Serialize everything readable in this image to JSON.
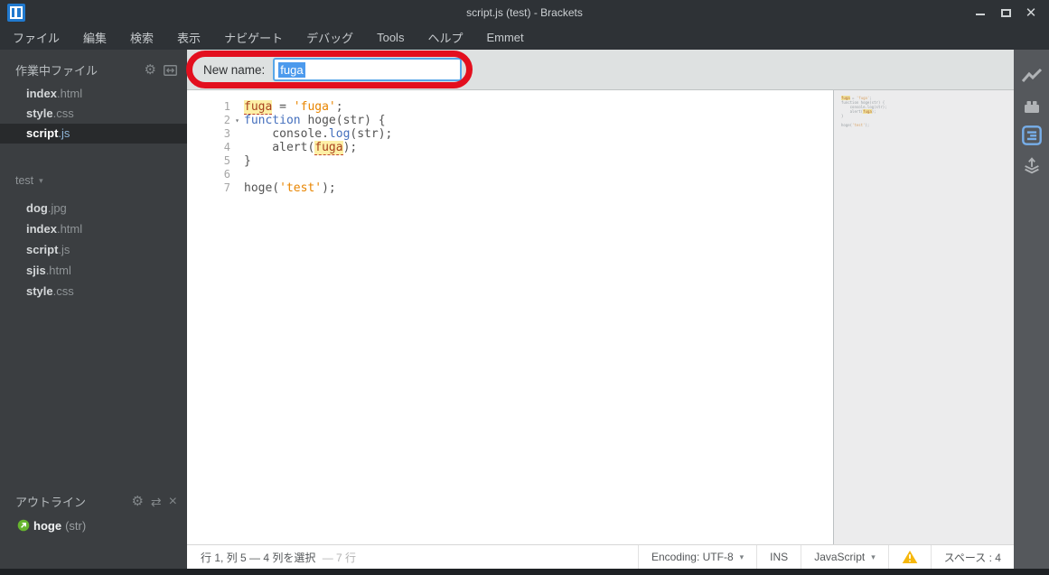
{
  "window": {
    "title": "script.js (test) - Brackets"
  },
  "menu_items": [
    "ファイル",
    "編集",
    "検索",
    "表示",
    "ナビゲート",
    "デバッグ",
    "Tools",
    "ヘルプ",
    "Emmet"
  ],
  "sidebar": {
    "working_title": "作業中ファイル",
    "working_files": [
      {
        "base": "index",
        "ext": ".html",
        "active": false
      },
      {
        "base": "style",
        "ext": ".css",
        "active": false
      },
      {
        "base": "script",
        "ext": ".js",
        "active": true
      }
    ],
    "project_name": "test",
    "project_files": [
      {
        "base": "dog",
        "ext": ".jpg"
      },
      {
        "base": "index",
        "ext": ".html"
      },
      {
        "base": "script",
        "ext": ".js"
      },
      {
        "base": "sjis",
        "ext": ".html"
      },
      {
        "base": "style",
        "ext": ".css"
      }
    ],
    "outline_title": "アウトライン",
    "outline_items": [
      {
        "name": "hoge",
        "args": "(str)"
      }
    ]
  },
  "rename_bar": {
    "label": "New name:",
    "value": "fuga"
  },
  "editor": {
    "lines": [
      {
        "num": 1,
        "fold": false,
        "segments": [
          {
            "text": "fuga",
            "type": "hl"
          },
          {
            "text": " = ",
            "type": "plain"
          },
          {
            "text": "'fuga'",
            "type": "string"
          },
          {
            "text": ";",
            "type": "plain"
          }
        ]
      },
      {
        "num": 2,
        "fold": true,
        "segments": [
          {
            "text": "function",
            "type": "keyword"
          },
          {
            "text": " hoge(str) {",
            "type": "plain"
          }
        ]
      },
      {
        "num": 3,
        "fold": false,
        "segments": [
          {
            "text": "    console.",
            "type": "plain"
          },
          {
            "text": "log",
            "type": "property"
          },
          {
            "text": "(str);",
            "type": "plain"
          }
        ]
      },
      {
        "num": 4,
        "fold": false,
        "segments": [
          {
            "text": "    alert(",
            "type": "plain"
          },
          {
            "text": "fuga",
            "type": "hl"
          },
          {
            "text": ");",
            "type": "plain"
          }
        ]
      },
      {
        "num": 5,
        "fold": false,
        "segments": [
          {
            "text": "}",
            "type": "plain"
          }
        ]
      },
      {
        "num": 6,
        "fold": false,
        "segments": []
      },
      {
        "num": 7,
        "fold": false,
        "segments": [
          {
            "text": "hoge(",
            "type": "plain"
          },
          {
            "text": "'test'",
            "type": "string"
          },
          {
            "text": ");",
            "type": "plain"
          }
        ]
      }
    ]
  },
  "statusbar": {
    "cursor": "行 1, 列 5 — 4 列を選択",
    "lines": "— 7 行",
    "encoding": "Encoding: UTF-8",
    "ins": "INS",
    "language": "JavaScript",
    "indent": "スペース : 4"
  },
  "colors": {
    "accent_blue": "#58a7e9",
    "selection_blue": "#4c9aed",
    "annotation_red": "#e30f1e",
    "keyword_blue": "#446fbd",
    "string_orange": "#e88501",
    "warning_yellow": "#f6b70c"
  }
}
